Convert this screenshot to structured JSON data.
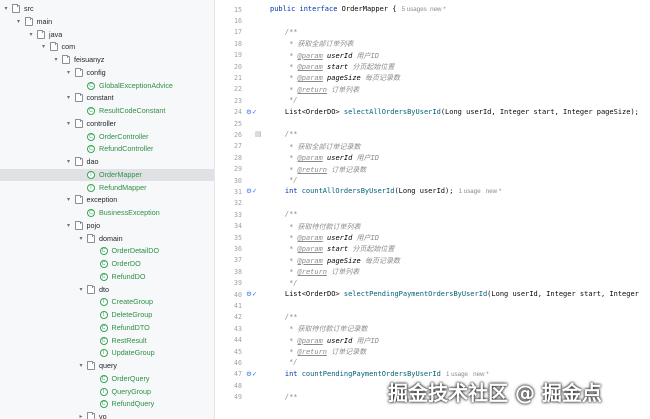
{
  "tree": {
    "items": [
      {
        "label": "src",
        "type": "folder",
        "indent": 0,
        "open": true
      },
      {
        "label": "main",
        "type": "folder",
        "indent": 1,
        "open": true
      },
      {
        "label": "java",
        "type": "folder",
        "indent": 2,
        "open": true
      },
      {
        "label": "com",
        "type": "folder",
        "indent": 3,
        "open": true
      },
      {
        "label": "feisuanyz",
        "type": "folder",
        "indent": 4,
        "open": true
      },
      {
        "label": "config",
        "type": "folder",
        "indent": 5,
        "open": true
      },
      {
        "label": "GlobalExceptionAdvice",
        "type": "class",
        "indent": 6
      },
      {
        "label": "constant",
        "type": "folder",
        "indent": 5,
        "open": true
      },
      {
        "label": "ResultCodeConstant",
        "type": "class",
        "indent": 6
      },
      {
        "label": "controller",
        "type": "folder",
        "indent": 5,
        "open": true
      },
      {
        "label": "OrderController",
        "type": "class",
        "indent": 6
      },
      {
        "label": "RefundController",
        "type": "class",
        "indent": 6
      },
      {
        "label": "dao",
        "type": "folder",
        "indent": 5,
        "open": true
      },
      {
        "label": "OrderMapper",
        "type": "interface",
        "indent": 6,
        "selected": true
      },
      {
        "label": "RefundMapper",
        "type": "interface",
        "indent": 6
      },
      {
        "label": "exception",
        "type": "folder",
        "indent": 5,
        "open": true
      },
      {
        "label": "BusinessException",
        "type": "class",
        "indent": 6
      },
      {
        "label": "pojo",
        "type": "folder",
        "indent": 5,
        "open": true
      },
      {
        "label": "domain",
        "type": "folder",
        "indent": 6,
        "open": true
      },
      {
        "label": "OrderDetailDO",
        "type": "class",
        "indent": 7
      },
      {
        "label": "OrderDO",
        "type": "class",
        "indent": 7
      },
      {
        "label": "RefundDO",
        "type": "class",
        "indent": 7
      },
      {
        "label": "dto",
        "type": "folder",
        "indent": 6,
        "open": true
      },
      {
        "label": "CreateGroup",
        "type": "interface",
        "indent": 7
      },
      {
        "label": "DeleteGroup",
        "type": "interface",
        "indent": 7
      },
      {
        "label": "RefundDTO",
        "type": "class",
        "indent": 7
      },
      {
        "label": "RestResult",
        "type": "class",
        "indent": 7
      },
      {
        "label": "UpdateGroup",
        "type": "interface",
        "indent": 7
      },
      {
        "label": "query",
        "type": "folder",
        "indent": 6,
        "open": true
      },
      {
        "label": "OrderQuery",
        "type": "class",
        "indent": 7
      },
      {
        "label": "QueryGroup",
        "type": "interface",
        "indent": 7
      },
      {
        "label": "RefundQuery",
        "type": "class",
        "indent": 7
      },
      {
        "label": "vo",
        "type": "folder",
        "indent": 6,
        "open": false
      }
    ]
  },
  "editor": {
    "lines": [
      {
        "n": "15",
        "t": "header",
        "kw": "public interface ",
        "name": "OrderMapper",
        "rest": " {",
        "hint": "5 usages  new *"
      },
      {
        "n": "16",
        "t": "blank"
      },
      {
        "n": "17",
        "t": "cmt",
        "text": "/**"
      },
      {
        "n": "18",
        "t": "cmt",
        "text": " * 获取全部订单列表"
      },
      {
        "n": "19",
        "t": "param",
        "tag": "@param",
        "p": "userId",
        "d": "用户ID"
      },
      {
        "n": "20",
        "t": "param",
        "tag": "@param",
        "p": "start",
        "d": "分页起始位置"
      },
      {
        "n": "21",
        "t": "param",
        "tag": "@param",
        "p": "pageSize",
        "d": "每页记录数"
      },
      {
        "n": "22",
        "t": "ret",
        "tag": "@return",
        "d": "订单列表"
      },
      {
        "n": "23",
        "t": "cmt",
        "text": " */"
      },
      {
        "n": "24",
        "t": "method",
        "gm": true,
        "pre": "List<OrderDO> ",
        "name": "selectAllOrdersByUserId",
        "args": "(Long userId, Integer start, Integer pageSize);"
      },
      {
        "n": "25",
        "t": "blank"
      },
      {
        "n": "26",
        "t": "cmt",
        "text": "/**",
        "fold": true
      },
      {
        "n": "27",
        "t": "cmt",
        "text": " * 获取全部订单记录数"
      },
      {
        "n": "28",
        "t": "param",
        "tag": "@param",
        "p": "userId",
        "d": "用户ID"
      },
      {
        "n": "29",
        "t": "ret",
        "tag": "@return",
        "d": "订单记录数"
      },
      {
        "n": "30",
        "t": "cmt",
        "text": " */"
      },
      {
        "n": "31",
        "t": "method",
        "gm": true,
        "kwpre": "int ",
        "name": "countAllOrdersByUserId",
        "args": "(Long userId);",
        "hint": "1 usage   new *"
      },
      {
        "n": "32",
        "t": "blank"
      },
      {
        "n": "33",
        "t": "cmt",
        "text": "/**"
      },
      {
        "n": "34",
        "t": "cmt",
        "text": " * 获取待付款订单列表"
      },
      {
        "n": "35",
        "t": "param",
        "tag": "@param",
        "p": "userId",
        "d": "用户ID"
      },
      {
        "n": "36",
        "t": "param",
        "tag": "@param",
        "p": "start",
        "d": "分页起始位置"
      },
      {
        "n": "37",
        "t": "param",
        "tag": "@param",
        "p": "pageSize",
        "d": "每页记录数"
      },
      {
        "n": "38",
        "t": "ret",
        "tag": "@return",
        "d": "订单列表"
      },
      {
        "n": "39",
        "t": "cmt",
        "text": " */"
      },
      {
        "n": "40",
        "t": "method",
        "gm": true,
        "pre": "List<OrderDO> ",
        "name": "selectPendingPaymentOrdersByUserId",
        "args": "(Long userId, Integer start, Integer"
      },
      {
        "n": "41",
        "t": "blank"
      },
      {
        "n": "42",
        "t": "cmt",
        "text": "/**"
      },
      {
        "n": "43",
        "t": "cmt",
        "text": " * 获取待付款订单记录数"
      },
      {
        "n": "44",
        "t": "param",
        "tag": "@param",
        "p": "userId",
        "d": "用户ID"
      },
      {
        "n": "45",
        "t": "ret",
        "tag": "@return",
        "d": "订单记录数"
      },
      {
        "n": "46",
        "t": "cmt",
        "text": " */"
      },
      {
        "n": "47",
        "t": "method",
        "gm": true,
        "kwpre": "int ",
        "name": "countPendingPaymentOrdersByUserId",
        "args": "",
        "hint": "1 usage   new *"
      },
      {
        "n": "48",
        "t": "blank"
      },
      {
        "n": "49",
        "t": "cmt",
        "text": "/**"
      }
    ]
  },
  "watermark": "掘金技术社区 @ 掘金点"
}
